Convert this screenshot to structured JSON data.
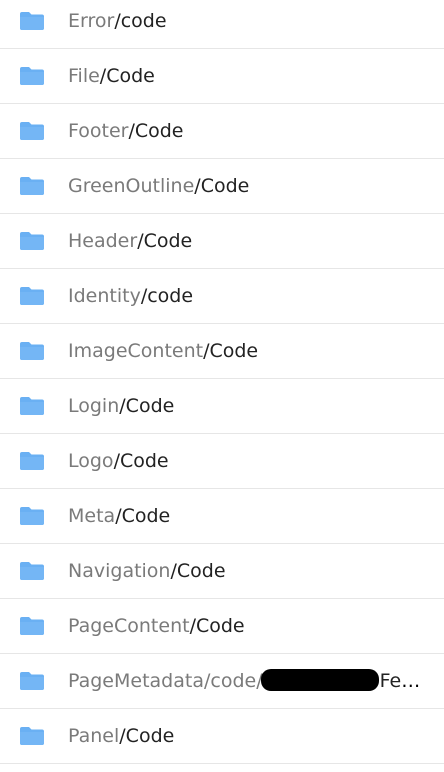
{
  "folders": [
    {
      "name": "Error",
      "sep": "/",
      "leaf": "code",
      "icon": "folder-icon"
    },
    {
      "name": "File",
      "sep": "/",
      "leaf": "Code",
      "icon": "folder-icon"
    },
    {
      "name": "Footer",
      "sep": "/",
      "leaf": "Code",
      "icon": "folder-icon"
    },
    {
      "name": "GreenOutline",
      "sep": "/",
      "leaf": "Code",
      "icon": "folder-icon"
    },
    {
      "name": "Header",
      "sep": "/",
      "leaf": "Code",
      "icon": "folder-icon"
    },
    {
      "name": "Identity",
      "sep": "/",
      "leaf": "code",
      "icon": "folder-icon"
    },
    {
      "name": "ImageContent",
      "sep": "/",
      "leaf": "Code",
      "icon": "folder-icon"
    },
    {
      "name": "Login",
      "sep": "/",
      "leaf": "Code",
      "icon": "folder-icon"
    },
    {
      "name": "Logo",
      "sep": "/",
      "leaf": "Code",
      "icon": "folder-icon"
    },
    {
      "name": "Meta",
      "sep": "/",
      "leaf": "Code",
      "icon": "folder-icon"
    },
    {
      "name": "Navigation",
      "sep": "/",
      "leaf": "Code",
      "icon": "folder-icon"
    },
    {
      "name": "PageContent",
      "sep": "/",
      "leaf": "Code",
      "icon": "folder-icon"
    },
    {
      "name": "PageMetadata/code/",
      "sep": "",
      "leaf": "Feat...",
      "icon": "folder-icon",
      "redacted": true
    },
    {
      "name": "Panel",
      "sep": "/",
      "leaf": "Code",
      "icon": "folder-icon"
    }
  ],
  "colors": {
    "folder_fill": "#6ab0f3",
    "folder_tab": "#5aa2ec",
    "path_text": "#7a7a7a",
    "leaf_text": "#222222",
    "divider": "#e6e6e6"
  }
}
